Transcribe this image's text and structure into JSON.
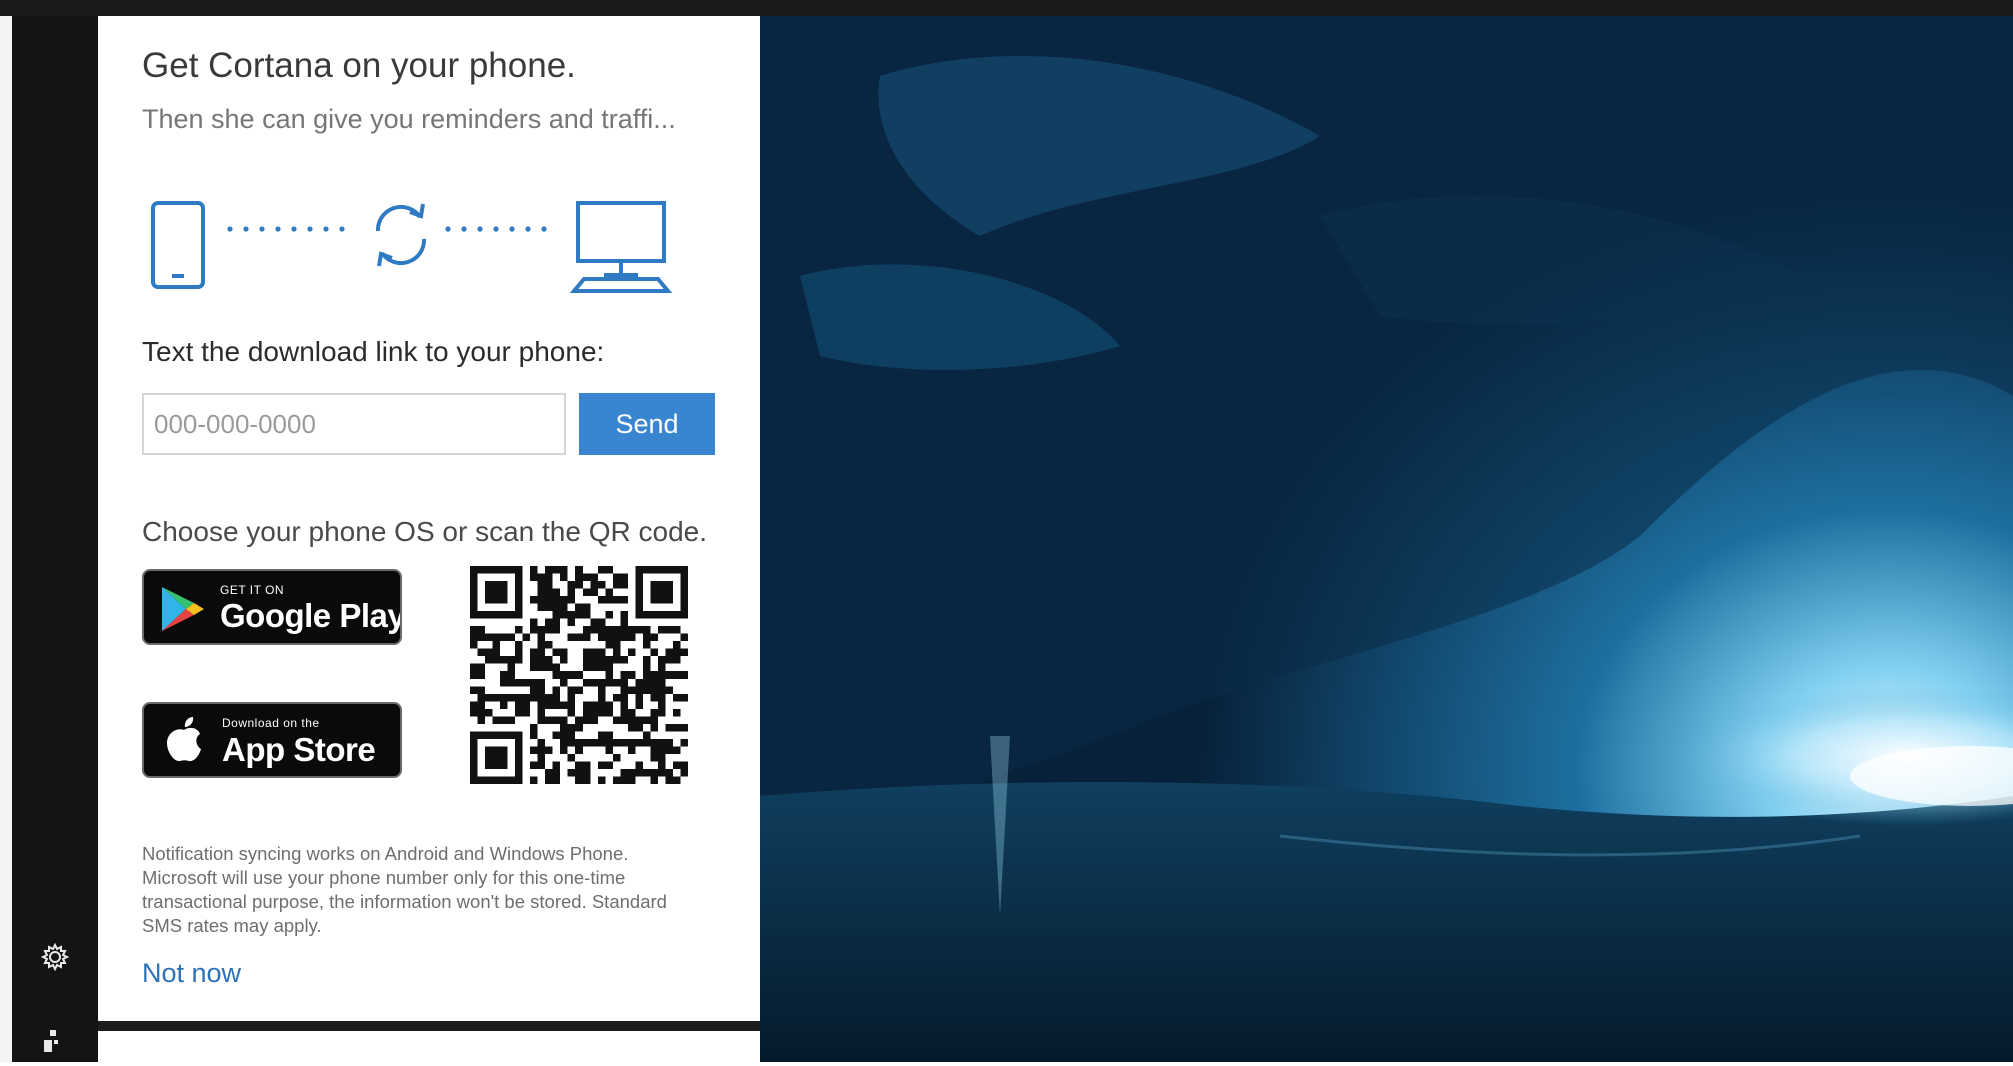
{
  "panel": {
    "title": "Get Cortana on your phone.",
    "subtitle": "Then she can give you reminders and traffi...",
    "text_link_label": "Text the download link to your phone:",
    "phone_input": {
      "placeholder": "000-000-0000",
      "value": ""
    },
    "send_label": "Send",
    "choose_os_label": "Choose your phone OS or scan the QR code.",
    "google_play": {
      "small": "GET IT ON",
      "big": "Google Play"
    },
    "app_store": {
      "small": "Download on the",
      "big": "App Store"
    },
    "disclaimer": "Notification syncing works on Android and Windows Phone. Microsoft will use your phone number only for this one-time transactional purpose, the information won't be stored. Standard SMS rates may apply.",
    "not_now_label": "Not now"
  },
  "rail": {
    "icons": [
      "gear-icon",
      "feedback-icon"
    ]
  },
  "colors": {
    "accent": "#3a85cf",
    "link": "#2c72b8",
    "icon_blue": "#2e7bc4",
    "rail_bg": "#141414"
  }
}
